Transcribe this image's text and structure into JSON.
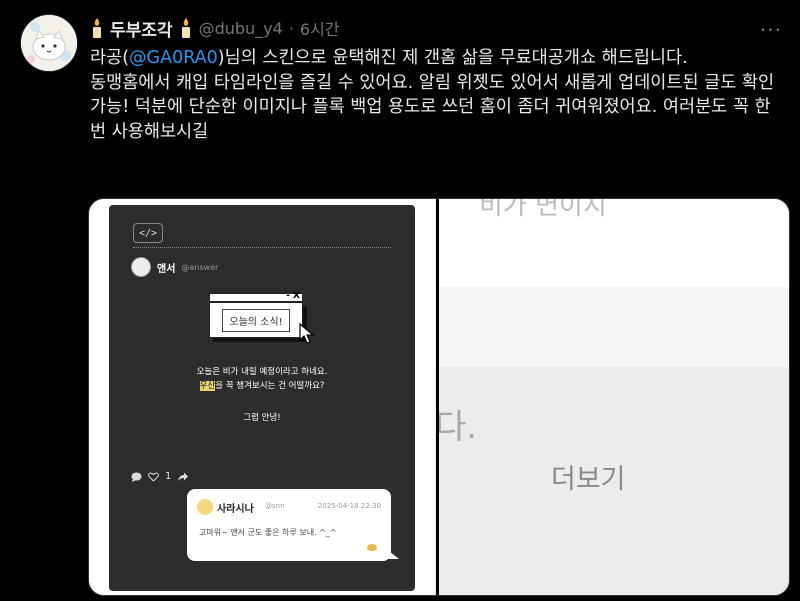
{
  "tweet": {
    "display_name": "두부조각",
    "handle": "@dubu_y4",
    "separator": "·",
    "time": "6시간",
    "more": "···",
    "line1_prefix": "라공(",
    "mention": "@GA0RA0",
    "line1_suffix": ")님의 스킨으로 윤택해진 제 갠홈 삶을 무료대공개쇼 해드립니다.",
    "line2": "동맹홈에서 캐입 타임라인을 즐길 수 있어요. 알림 위젯도 있어서 새롭게 업데이트된 글도 확인 가능! 덕분에 단순한 이미지나 플록 백업 용도로 쓰던 홈이 좀더 귀여워졌어요. 여러분도 꼭 한번 사용해보시길"
  },
  "media": {
    "code_button": "</>",
    "profile_name": "앤서",
    "profile_handle": "@answer",
    "window_close": "- X",
    "window_title": "오늘의 소식!",
    "news_line1": "오늘은 비가 내릴 예정이라고 하네요.",
    "news_highlight": "우산",
    "news_line2_rest": "을 꼭 챙겨보시는 건 어떨까요?",
    "bye": "그럼 안녕!",
    "like_count": "1",
    "reply": {
      "name": "사라시나",
      "handle": "@snn",
      "date": "2025-04-18 22:30",
      "text": "고마워~ 앤서 군도 좋은 하루 보내. ^_^"
    },
    "right_top_text": "비가 면이지",
    "right_mid_text": "다.",
    "right_more": "더보기"
  }
}
